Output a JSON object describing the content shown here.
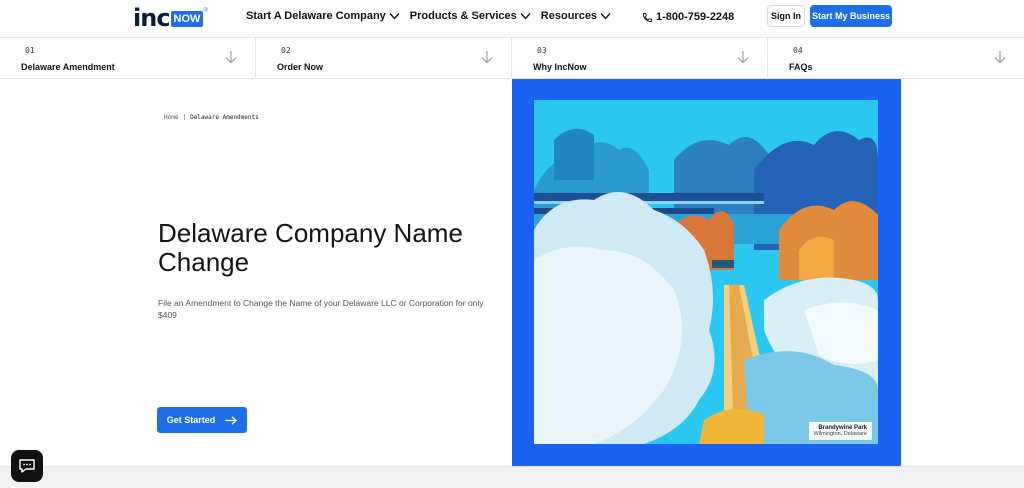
{
  "header": {
    "logo_inc": "inc",
    "logo_now": "NOW",
    "logo_reg": "®",
    "nav": [
      {
        "label": "Start A Delaware Company",
        "icon": "chevron-down-icon"
      },
      {
        "label": "Products & Services",
        "icon": "chevron-down-icon"
      },
      {
        "label": "Resources",
        "icon": "chevron-down-icon"
      }
    ],
    "phone": "1-800-759-2248",
    "sign_in": "Sign In",
    "start_business": "Start My Business"
  },
  "steps": [
    {
      "num": "01",
      "label": "Delaware Amendment"
    },
    {
      "num": "02",
      "label": "Order Now"
    },
    {
      "num": "03",
      "label": "Why IncNow"
    },
    {
      "num": "04",
      "label": "FAQs"
    }
  ],
  "breadcrumb": {
    "home": "Home",
    "separator": "|",
    "current": "Delaware Amendments"
  },
  "hero": {
    "title": "Delaware Company Name Change",
    "subtitle": "File an Amendment to Change the Name of your Delaware LLC or Corporation for only $409",
    "cta": "Get Started"
  },
  "artwork": {
    "caption_title": "Brandywine Park",
    "caption_subtitle": "Wilmington, Delaware"
  },
  "colors": {
    "accent": "#1d6fe8",
    "frame": "#1a63f2",
    "sky": "#29c6ee"
  }
}
